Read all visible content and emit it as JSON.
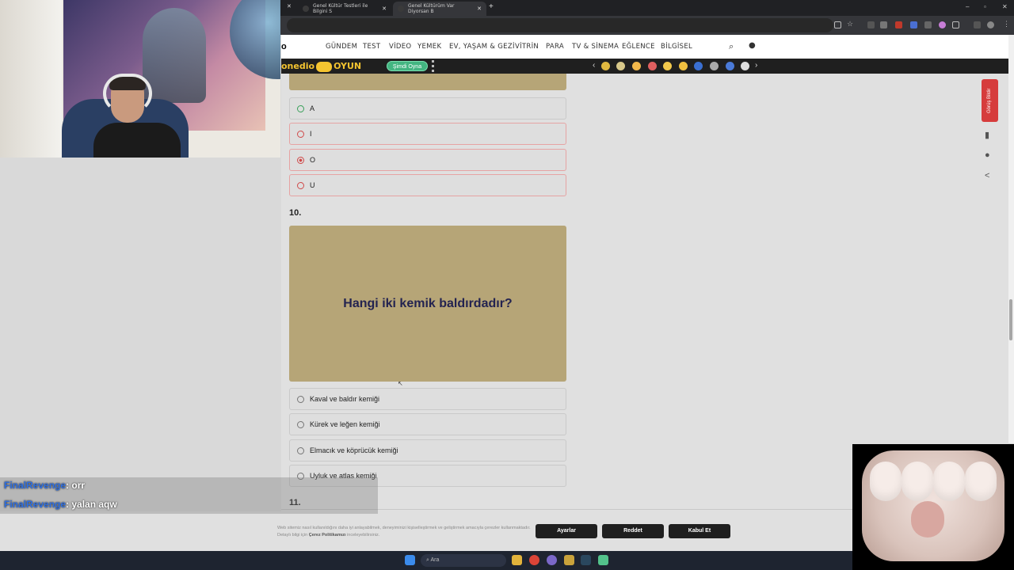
{
  "browser": {
    "tabs": [
      {
        "title": "Genel Kültür Testleri ile Bilgini S"
      },
      {
        "title": "Genel Kültürüm Var Diyorsan B"
      }
    ]
  },
  "site": {
    "nav": [
      "GÜNDEM",
      "TEST",
      "VİDEO",
      "YEMEK",
      "EV, YAŞAM & GEZİ",
      "VİTRİN",
      "PARA",
      "TV & SİNEMA",
      "EĞLENCE",
      "BİLGİSEL"
    ],
    "game_bar": {
      "brand_left": "onedio",
      "brand_right": "OYUN",
      "play_label": "Şimdi Oyna"
    }
  },
  "quiz": {
    "prev_options": [
      {
        "label": "A",
        "state": "correct"
      },
      {
        "label": "I",
        "state": "wrong"
      },
      {
        "label": "O",
        "state": "selected"
      },
      {
        "label": "U",
        "state": "wrong"
      }
    ],
    "q10": {
      "number": "10.",
      "question": "Hangi iki kemik baldırdadır?",
      "options": [
        "Kaval ve baldır kemiği",
        "Kürek ve leğen kemiği",
        "Elmacık ve köprücük kemiği",
        "Uyluk ve atlas kemiği"
      ]
    },
    "next_number": "11."
  },
  "sidebar": {
    "report_label": "Görüş Bildir"
  },
  "cookie": {
    "text_main": "Web sitemiz nasıl kullanıldığını daha iyi anlayabilmek, deneyiminizi kişiselleştirmek ve geliştirmek amacıyla çerezler kullanmaktadır. Detaylı bilgi için",
    "policy_link": "Çerez Politikamızı",
    "text_end": "inceleyebilirsiniz.",
    "buttons": {
      "settings": "Ayarlar",
      "reject": "Reddet",
      "accept": "Kabul Et"
    }
  },
  "taskbar": {
    "search_placeholder": "Ara"
  },
  "chat": [
    {
      "user": "FinalRevenge",
      "message": ": orr"
    },
    {
      "user": "FinalRevenge",
      "message": ": yalan aqw"
    }
  ]
}
